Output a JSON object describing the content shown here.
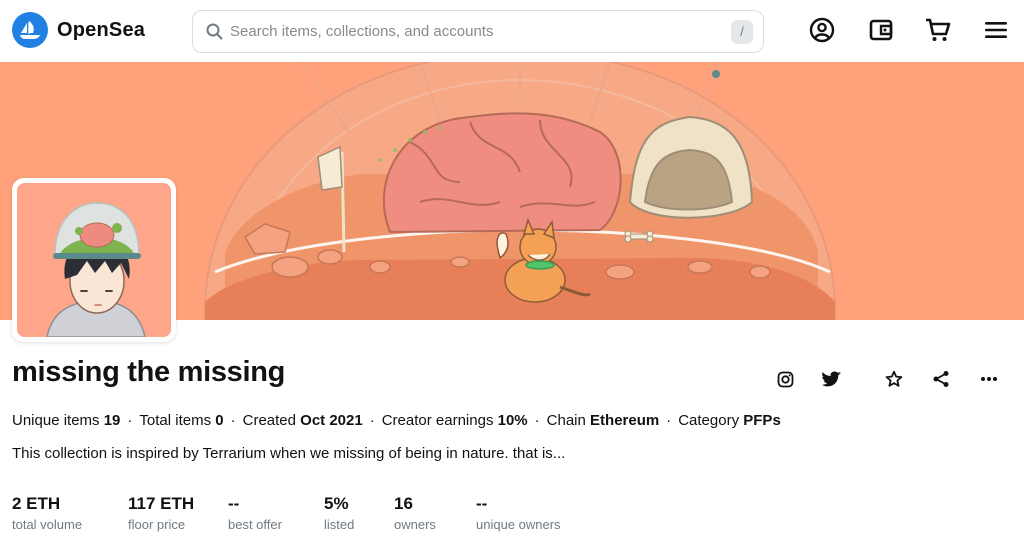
{
  "header": {
    "brand": "OpenSea",
    "search_placeholder": "Search items, collections, and accounts",
    "search_shortcut": "/",
    "icons": [
      "profile-icon",
      "wallet-icon",
      "cart-icon",
      "menu-icon"
    ]
  },
  "colors": {
    "brand_blue": "#2081e2",
    "banner_bg": "#ffa27b",
    "avatar_bg": "#ffa58a",
    "muted_text": "#707a83"
  },
  "collection": {
    "name": "missing the missing",
    "meta": [
      {
        "label": "Unique items",
        "value": "19"
      },
      {
        "label": "Total items",
        "value": "0"
      },
      {
        "label": "Created",
        "value": "Oct 2021"
      },
      {
        "label": "Creator earnings",
        "value": "10%"
      },
      {
        "label": "Chain",
        "value": "Ethereum"
      },
      {
        "label": "Category",
        "value": "PFPs"
      }
    ],
    "separator": "·",
    "description": "This collection is inspired by Terrarium when we missing of being in nature. that is...",
    "actions": [
      "instagram-icon",
      "twitter-icon",
      "star-icon",
      "share-icon",
      "more-icon"
    ]
  },
  "stats": [
    {
      "value": "2 ETH",
      "label": "total volume"
    },
    {
      "value": "117 ETH",
      "label": "floor price"
    },
    {
      "value": "--",
      "label": "best offer"
    },
    {
      "value": "5%",
      "label": "listed"
    },
    {
      "value": "16",
      "label": "owners"
    },
    {
      "value": "--",
      "label": "unique owners"
    }
  ]
}
